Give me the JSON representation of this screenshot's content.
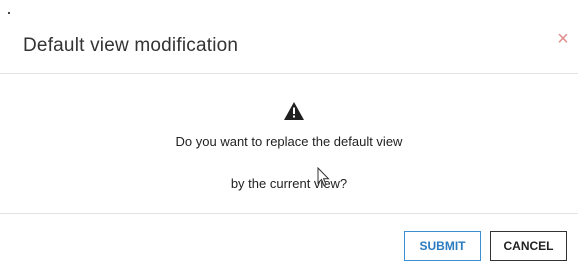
{
  "dialog": {
    "title": "Default view modification",
    "close_glyph": "×",
    "icon": "warning-icon",
    "message_line_1": "Do you want to replace the default view",
    "message_line_2": "by the current view?",
    "buttons": {
      "submit_label": "SUBMIT",
      "cancel_label": "CANCEL"
    }
  },
  "colors": {
    "accent": "#2b7bc0",
    "close": "#e08b8b",
    "divider": "#e3e3e3"
  }
}
